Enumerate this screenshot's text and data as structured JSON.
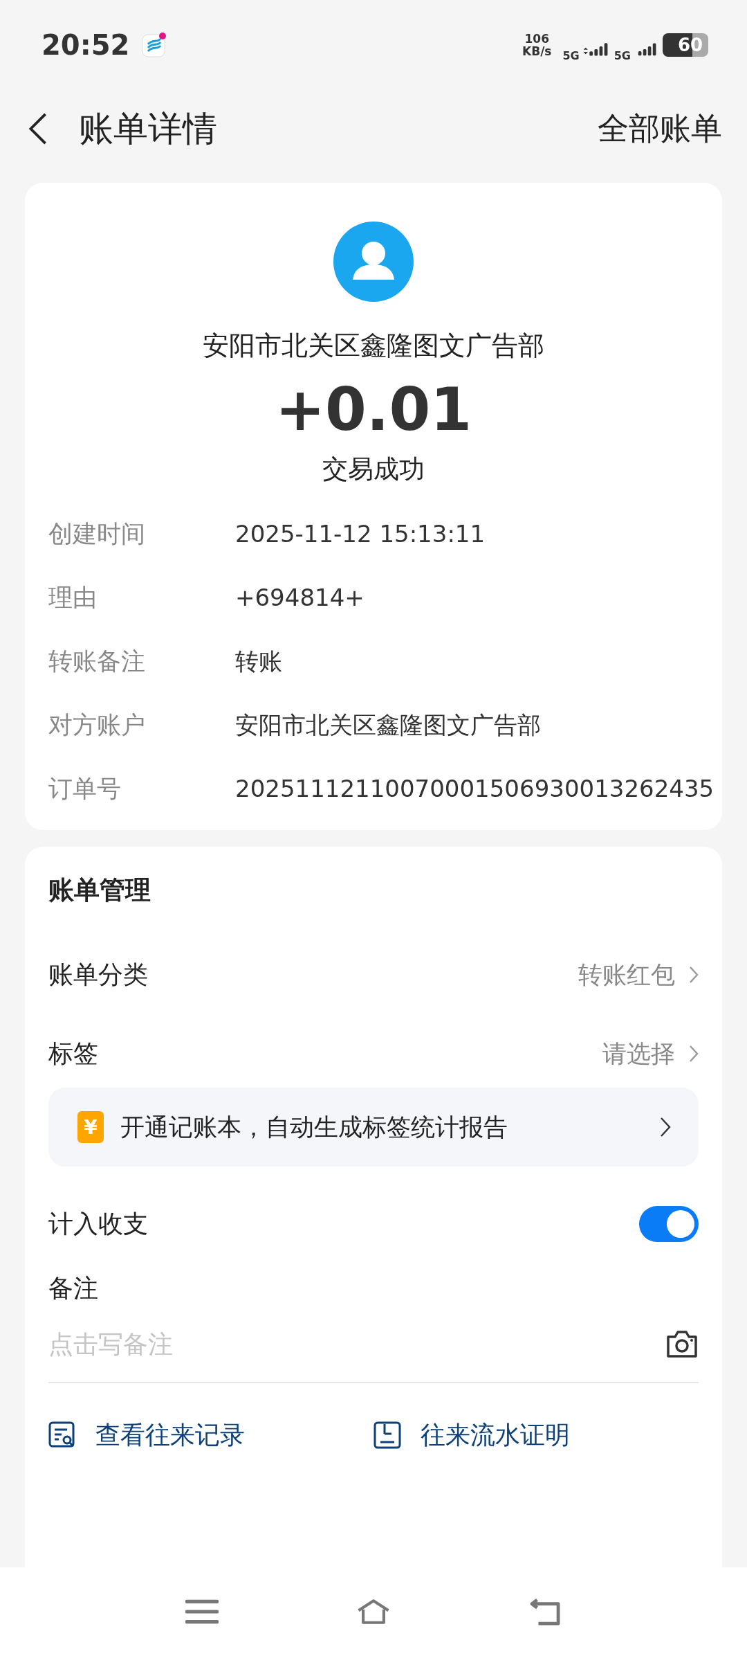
{
  "status_bar": {
    "time": "20:52",
    "speed_value": "106",
    "speed_unit": "KB/s",
    "network_1": "5G",
    "network_2": "5G",
    "battery": "60"
  },
  "header": {
    "title": "账单详情",
    "action": "全部账单"
  },
  "summary": {
    "payee": "安阳市北关区鑫隆图文广告部",
    "amount": "+0.01",
    "status": "交易成功"
  },
  "details": [
    {
      "label": "创建时间",
      "value": "2025-11-12 15:13:11"
    },
    {
      "label": "理由",
      "value": "+694814+"
    },
    {
      "label": "转账备注",
      "value": "转账"
    },
    {
      "label": "对方账户",
      "value": "安阳市北关区鑫隆图文广告部"
    },
    {
      "label": "订单号",
      "value": "20251112110070001506930013262435"
    }
  ],
  "management": {
    "title": "账单管理",
    "rows": [
      {
        "label": "账单分类",
        "value": "转账红包"
      },
      {
        "label": "标签",
        "value": "请选择"
      }
    ],
    "promo": {
      "icon_text": "¥",
      "text": "开通记账本，自动生成标签统计报告"
    },
    "count_in": {
      "label": "计入收支",
      "on": true
    },
    "note": {
      "label": "备注",
      "placeholder": "点击写备注"
    },
    "links": [
      {
        "kind": "records",
        "label": "查看往来记录"
      },
      {
        "kind": "proof",
        "label": "往来流水证明"
      }
    ]
  }
}
